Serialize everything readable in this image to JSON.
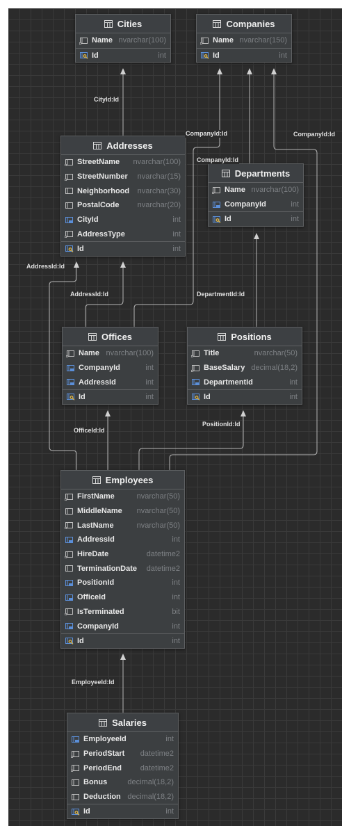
{
  "tables": [
    {
      "id": "cities",
      "name": "Cities",
      "columns": [
        {
          "name": "Name",
          "type": "nvarchar(100)",
          "icon": "column"
        },
        {
          "name": "Id",
          "type": "int",
          "icon": "primary-key",
          "pk": true
        }
      ]
    },
    {
      "id": "companies",
      "name": "Companies",
      "columns": [
        {
          "name": "Name",
          "type": "nvarchar(150)",
          "icon": "column"
        },
        {
          "name": "Id",
          "type": "int",
          "icon": "primary-key",
          "pk": true
        }
      ]
    },
    {
      "id": "addresses",
      "name": "Addresses",
      "columns": [
        {
          "name": "StreetName",
          "type": "nvarchar(100)",
          "icon": "column"
        },
        {
          "name": "StreetNumber",
          "type": "nvarchar(15)",
          "icon": "column"
        },
        {
          "name": "Neighborhood",
          "type": "nvarchar(30)",
          "icon": "nullable-column"
        },
        {
          "name": "PostalCode",
          "type": "nvarchar(20)",
          "icon": "nullable-column"
        },
        {
          "name": "CityId",
          "type": "int",
          "icon": "foreign-key"
        },
        {
          "name": "AddressType",
          "type": "int",
          "icon": "column"
        },
        {
          "name": "Id",
          "type": "int",
          "icon": "primary-key",
          "pk": true
        }
      ]
    },
    {
      "id": "departments",
      "name": "Departments",
      "columns": [
        {
          "name": "Name",
          "type": "nvarchar(100)",
          "icon": "column"
        },
        {
          "name": "CompanyId",
          "type": "int",
          "icon": "foreign-key"
        },
        {
          "name": "Id",
          "type": "int",
          "icon": "primary-key",
          "pk": true
        }
      ]
    },
    {
      "id": "offices",
      "name": "Offices",
      "columns": [
        {
          "name": "Name",
          "type": "nvarchar(100)",
          "icon": "column"
        },
        {
          "name": "CompanyId",
          "type": "int",
          "icon": "foreign-key"
        },
        {
          "name": "AddressId",
          "type": "int",
          "icon": "foreign-key"
        },
        {
          "name": "Id",
          "type": "int",
          "icon": "primary-key",
          "pk": true
        }
      ]
    },
    {
      "id": "positions",
      "name": "Positions",
      "columns": [
        {
          "name": "Title",
          "type": "nvarchar(50)",
          "icon": "column"
        },
        {
          "name": "BaseSalary",
          "type": "decimal(18,2)",
          "icon": "column"
        },
        {
          "name": "DepartmentId",
          "type": "int",
          "icon": "foreign-key"
        },
        {
          "name": "Id",
          "type": "int",
          "icon": "primary-key",
          "pk": true
        }
      ]
    },
    {
      "id": "employees",
      "name": "Employees",
      "columns": [
        {
          "name": "FirstName",
          "type": "nvarchar(50)",
          "icon": "column"
        },
        {
          "name": "MiddleName",
          "type": "nvarchar(50)",
          "icon": "nullable-column"
        },
        {
          "name": "LastName",
          "type": "nvarchar(50)",
          "icon": "column"
        },
        {
          "name": "AddressId",
          "type": "int",
          "icon": "foreign-key"
        },
        {
          "name": "HireDate",
          "type": "datetime2",
          "icon": "column"
        },
        {
          "name": "TerminationDate",
          "type": "datetime2",
          "icon": "nullable-column"
        },
        {
          "name": "PositionId",
          "type": "int",
          "icon": "foreign-key"
        },
        {
          "name": "OfficeId",
          "type": "int",
          "icon": "foreign-key"
        },
        {
          "name": "IsTerminated",
          "type": "bit",
          "icon": "column"
        },
        {
          "name": "CompanyId",
          "type": "int",
          "icon": "foreign-key"
        },
        {
          "name": "Id",
          "type": "int",
          "icon": "primary-key",
          "pk": true
        }
      ]
    },
    {
      "id": "salaries",
      "name": "Salaries",
      "columns": [
        {
          "name": "EmployeeId",
          "type": "int",
          "icon": "foreign-key"
        },
        {
          "name": "PeriodStart",
          "type": "datetime2",
          "icon": "column"
        },
        {
          "name": "PeriodEnd",
          "type": "datetime2",
          "icon": "column"
        },
        {
          "name": "Bonus",
          "type": "decimal(18,2)",
          "icon": "nullable-column"
        },
        {
          "name": "Deduction",
          "type": "decimal(18,2)",
          "icon": "nullable-column"
        },
        {
          "name": "Id",
          "type": "int",
          "icon": "primary-key",
          "pk": true
        }
      ]
    }
  ],
  "relations": [
    {
      "from": "addresses",
      "to": "cities",
      "label": "CityId:Id"
    },
    {
      "from": "departments",
      "to": "companies",
      "label": "CompanyId:Id"
    },
    {
      "from": "offices",
      "to": "companies",
      "label": "CompanyId:Id"
    },
    {
      "from": "offices",
      "to": "addresses",
      "label": "AddressId:Id"
    },
    {
      "from": "positions",
      "to": "departments",
      "label": "DepartmentId:Id"
    },
    {
      "from": "employees",
      "to": "addresses",
      "label": "AddressId:Id"
    },
    {
      "from": "employees",
      "to": "offices",
      "label": "OfficeId:Id"
    },
    {
      "from": "employees",
      "to": "positions",
      "label": "PositionId:Id"
    },
    {
      "from": "employees",
      "to": "companies",
      "label": "CompanyId:Id"
    },
    {
      "from": "salaries",
      "to": "employees",
      "label": "EmployeeId:Id"
    }
  ],
  "colors": {
    "background": "#2b2b2b",
    "grid": "#3a3a3a",
    "table_fill": "#3c3f41",
    "table_border": "#5e6062",
    "text": "#e6e6e6",
    "type_text": "#7d8084",
    "connector": "#b5b5b5",
    "key_icon": "#d9b24a",
    "fk_icon": "#5b8fd9"
  }
}
